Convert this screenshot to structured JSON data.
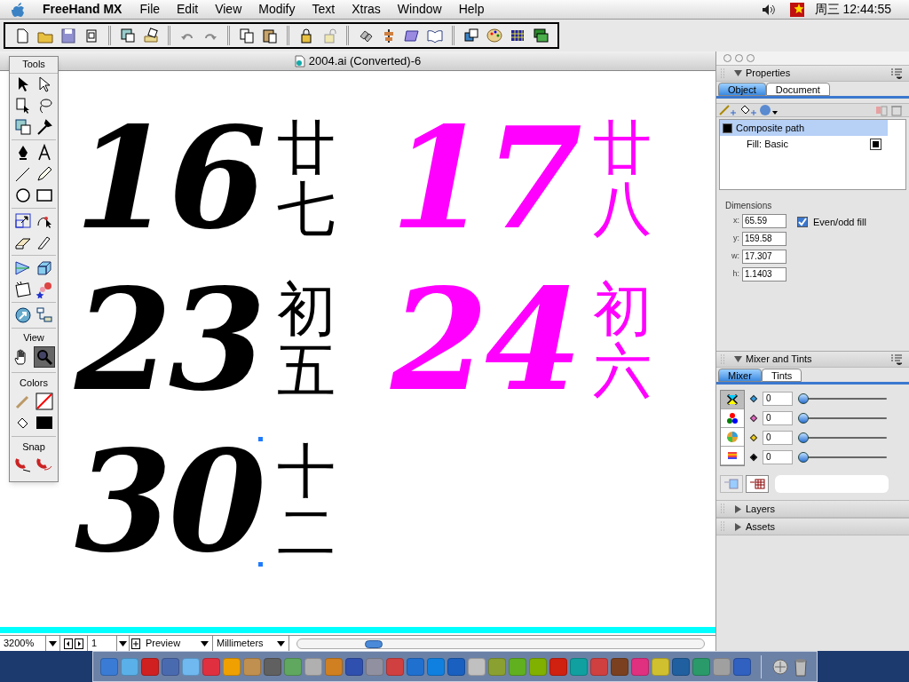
{
  "menu_bar": {
    "app_name": "FreeHand MX",
    "menus": [
      "File",
      "Edit",
      "View",
      "Modify",
      "Text",
      "Xtras",
      "Window",
      "Help"
    ],
    "clock": "周三 12:44:55"
  },
  "document": {
    "title": "2004.ai (Converted)-6"
  },
  "canvas": {
    "items": [
      {
        "number": "16",
        "lunar": "廿七",
        "color": "#000000",
        "selected": false
      },
      {
        "number": "17",
        "lunar": "廿八",
        "color": "#ff00ff",
        "selected": false
      },
      {
        "number": "23",
        "lunar": "初五",
        "color": "#000000",
        "selected": false
      },
      {
        "number": "24",
        "lunar": "初六",
        "color": "#ff00ff",
        "selected": false
      },
      {
        "number": "30",
        "lunar": "十二",
        "color": "#000000",
        "selected": true
      }
    ]
  },
  "tools_panel": {
    "title": "Tools",
    "sections": [
      "View",
      "Colors",
      "Snap"
    ]
  },
  "properties_panel": {
    "title": "Properties",
    "expanded": true,
    "tabs": [
      {
        "label": "Object",
        "selected": true
      },
      {
        "label": "Document",
        "selected": false
      }
    ],
    "object_list": [
      {
        "label": "Composite path",
        "selected": true,
        "indented": false
      },
      {
        "label": "Fill: Basic",
        "selected": false,
        "indented": true
      }
    ],
    "dimensions_label": "Dimensions",
    "fields": [
      {
        "label": "x:",
        "value": "65.59"
      },
      {
        "label": "y:",
        "value": "159.58"
      },
      {
        "label": "w:",
        "value": "17.307"
      },
      {
        "label": "h:",
        "value": "1.1403"
      }
    ],
    "even_odd_fill": {
      "label": "Even/odd fill",
      "checked": true
    }
  },
  "mixer_panel": {
    "title": "Mixer and Tints",
    "expanded": true,
    "tabs": [
      {
        "label": "Mixer",
        "selected": true
      },
      {
        "label": "Tints",
        "selected": false
      }
    ],
    "channels": [
      {
        "value": "0",
        "level": 0,
        "color": "#3399dd"
      },
      {
        "value": "0",
        "level": 0,
        "color": "#dd66bb"
      },
      {
        "value": "0",
        "level": 0,
        "color": "#eecc22"
      },
      {
        "value": "0",
        "level": 0,
        "color": "#000000"
      }
    ]
  },
  "collapsed_panels": [
    {
      "title": "Layers",
      "expanded": false
    },
    {
      "title": "Assets",
      "expanded": false
    }
  ],
  "status_bar": {
    "zoom": "3200%",
    "page": "1",
    "view_mode": "Preview",
    "units": "Millimeters"
  }
}
